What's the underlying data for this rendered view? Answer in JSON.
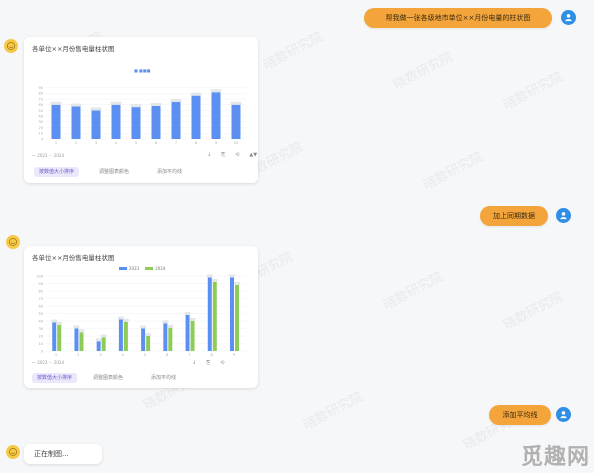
{
  "messages": {
    "user1": "帮我做一张各级地市单位××月份电量的柱状图",
    "user2": "加上同期数据",
    "user3": "添加平均线",
    "status": "正在制图..."
  },
  "chart1": {
    "title": "各单位××月份售电量柱状图",
    "legend_mini": "■ ■■■",
    "footer_legend": "— 2023  ···  2024",
    "buttons": [
      "按数值大小排序",
      "调整图表颜色",
      "添加平均线"
    ],
    "tools": [
      "↓",
      "⎘",
      "⟲",
      "▲▼"
    ]
  },
  "chart2": {
    "title": "各单位××月份售电量柱状图",
    "legend": [
      "2023",
      "2024"
    ],
    "footer_legend": "— 2023  ···  2024",
    "buttons": [
      "按数值大小排序",
      "调整图表颜色",
      "添加平均线"
    ],
    "tools": [
      "↓",
      "⎘",
      "⟲"
    ]
  },
  "watermark_text": "晓数研究院",
  "brand_text": "觅趣网",
  "colors": {
    "blue": "#5b8ff2",
    "green": "#8ccc57",
    "orange": "#f3a53b",
    "purple": "#6a5acd"
  },
  "chart_data": [
    {
      "type": "bar",
      "categories": [
        "1",
        "2",
        "3",
        "4",
        "5",
        "6",
        "7",
        "8",
        "9",
        "10"
      ],
      "values": [
        60,
        57,
        50,
        60,
        56,
        58,
        65,
        76,
        82,
        60
      ],
      "ylim": [
        0,
        100
      ],
      "yticks": [
        "0",
        "10",
        "20",
        "30",
        "40",
        "50",
        "60",
        "70",
        "80",
        "90"
      ]
    },
    {
      "type": "bar",
      "categories": [
        "1",
        "2",
        "3",
        "4",
        "5",
        "6",
        "7",
        "8",
        "9"
      ],
      "series": [
        {
          "name": "2023",
          "values": [
            38,
            30,
            13,
            42,
            30,
            37,
            48,
            98,
            98
          ]
        },
        {
          "name": "2024",
          "values": [
            35,
            25,
            18,
            39,
            20,
            31,
            40,
            92,
            88
          ]
        }
      ],
      "ylim": [
        0,
        100
      ],
      "yticks": [
        "0",
        "10",
        "20",
        "30",
        "40",
        "50",
        "60",
        "70",
        "80",
        "90",
        "100"
      ]
    }
  ]
}
